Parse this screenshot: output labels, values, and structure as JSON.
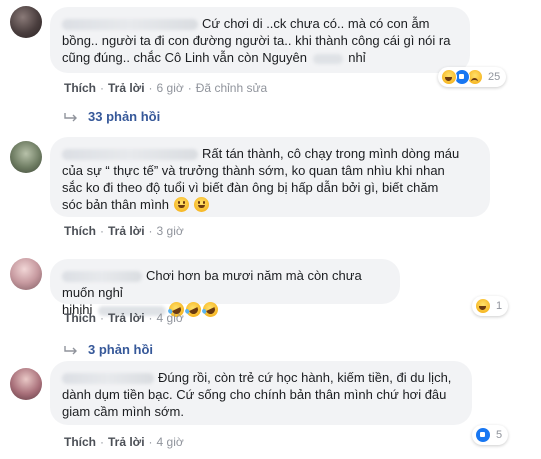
{
  "comments": [
    {
      "text_parts": [
        "Cứ chơi di ..ck chưa có.. mà có con ẫm",
        "bồng.. người ta đi con đường người ta.. khi thành công cái gì nói ra",
        "cũng đúng.. chắc Cô Linh vẫn còn Nguyên",
        "nhỉ"
      ],
      "actions": {
        "like": "Thích",
        "reply": "Trả lời",
        "time": "6 giờ",
        "edited": "Đã chỉnh sửa"
      },
      "reaction_count": "25",
      "reaction_icons": [
        "haha-icon",
        "like-icon",
        "sad-icon"
      ],
      "replies_label": "33 phản hồi"
    },
    {
      "text_parts": [
        "Rất tán thành, cô chạy trong mình dòng máu",
        "của sự “ thực tế” và trưởng thành sớm, ko quan tâm nhìu khi nhan",
        "sắc ko đi theo độ tuổi vì biết đàn ông bị hấp dẫn bởi gì, biết chăm",
        "sóc bản thân mình"
      ],
      "actions": {
        "like": "Thích",
        "reply": "Trả lời",
        "time": "3 giờ"
      }
    },
    {
      "text_parts": [
        "Chơi hơn ba mươi năm mà còn chưa muốn nghỉ",
        "hihihi"
      ],
      "actions": {
        "like": "Thích",
        "reply": "Trả lời",
        "time": "4 giờ"
      },
      "reaction_count": "1",
      "reaction_icons": [
        "haha-icon"
      ],
      "replies_label": "3 phản hồi"
    },
    {
      "text_parts": [
        "Đúng rồi, còn trẻ cứ học hành, kiếm tiền, đi du lịch,",
        "dành dụm tiền bạc. Cứ sống cho chính bản thân mình chứ hơi đâu",
        "giam cầm mình sớm."
      ],
      "actions": {
        "like": "Thích",
        "reply": "Trả lời",
        "time": "4 giờ"
      },
      "reaction_count": "5",
      "reaction_icons": [
        "like-icon"
      ]
    }
  ],
  "colors": {
    "link": "#365899",
    "meta": "#90949c",
    "bubble": "#f2f3f5",
    "like_blue": "#1877f2"
  }
}
